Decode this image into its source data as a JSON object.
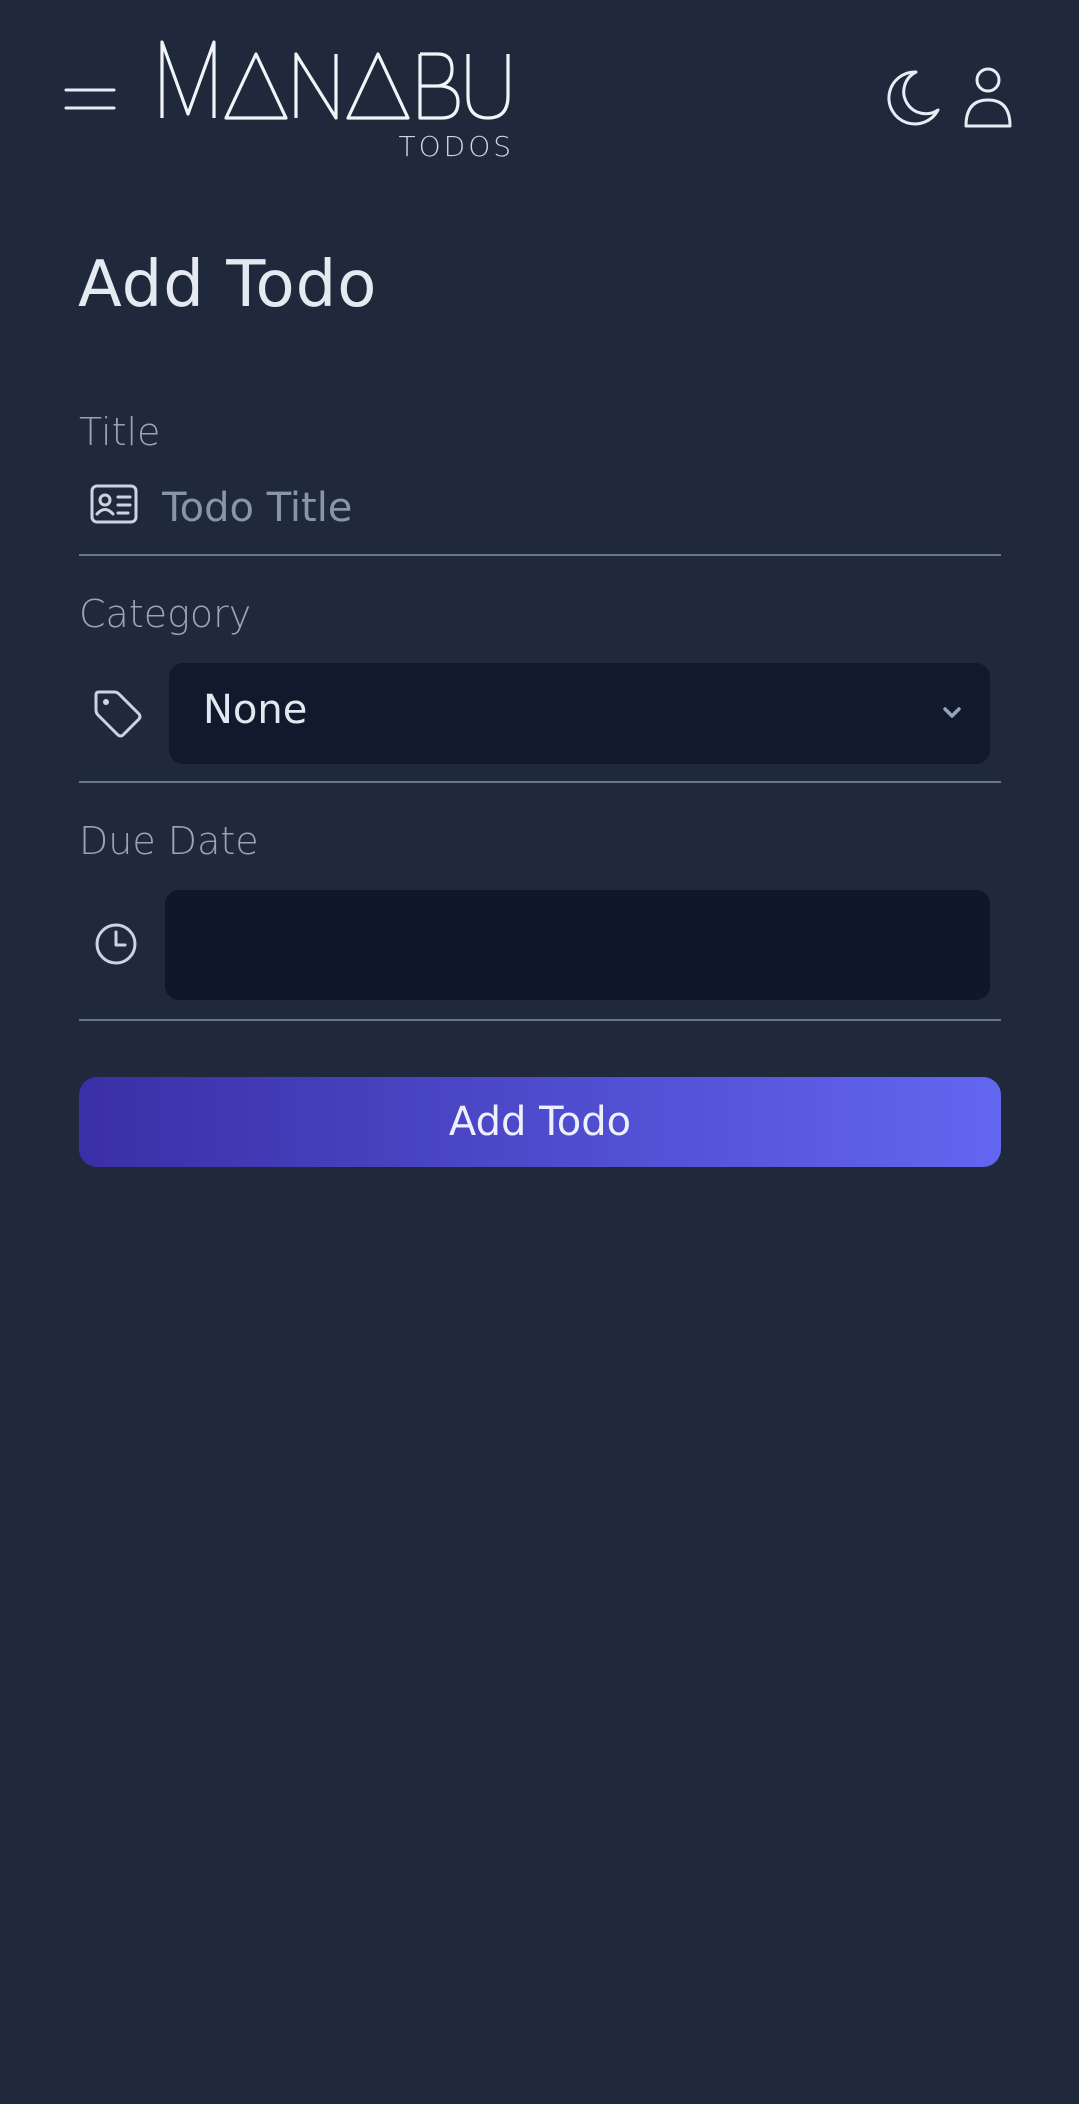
{
  "header": {
    "logo_text": "MANABU",
    "logo_subtitle": "TODOS",
    "menu_icon": "hamburger-menu-icon",
    "theme_icon": "moon-icon",
    "user_icon": "user-icon"
  },
  "page": {
    "title": "Add Todo"
  },
  "form": {
    "title_field": {
      "label": "Title",
      "placeholder": "Todo Title",
      "value": "",
      "icon": "id-card-icon"
    },
    "category_field": {
      "label": "Category",
      "selected": "None",
      "icon": "tag-icon"
    },
    "due_date_field": {
      "label": "Due Date",
      "value": "",
      "icon": "clock-icon"
    },
    "submit_label": "Add Todo"
  },
  "colors": {
    "background": "#1f293b",
    "input_background": "#111a2c",
    "button_gradient_start": "#3a2fa6",
    "button_gradient_end": "#6366f1"
  }
}
